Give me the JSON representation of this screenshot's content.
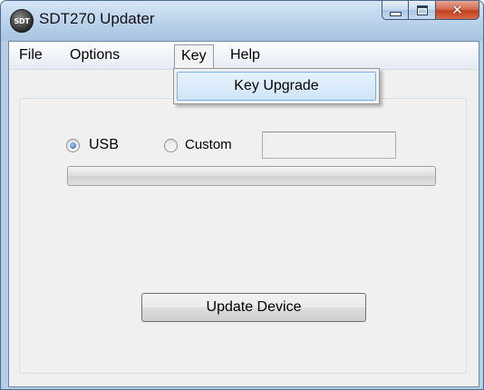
{
  "window": {
    "title": "SDT270 Updater",
    "icon_text": "SDT",
    "icon": "sdt-app-icon"
  },
  "caption_buttons": {
    "minimize_icon": "minimize-icon",
    "maximize_icon": "maximize-icon",
    "close_glyph": "✕"
  },
  "menu": {
    "items": [
      "File",
      "Options",
      "Key",
      "Help"
    ],
    "open_index": 2,
    "dropdown": {
      "items": [
        "Key Upgrade"
      ],
      "highlighted_index": 0
    }
  },
  "connection": {
    "usb_label": "USB",
    "usb_checked": true,
    "custom_label": "Custom",
    "custom_checked": false,
    "custom_value": ""
  },
  "progress": {
    "value_percent": 0
  },
  "actions": {
    "update_label": "Update Device"
  },
  "colors": {
    "selection_border": "#7aaee0",
    "selection_fill": "#d8e9fb",
    "close_button": "#c2401f",
    "radio_dot": "#1c5fa6"
  }
}
